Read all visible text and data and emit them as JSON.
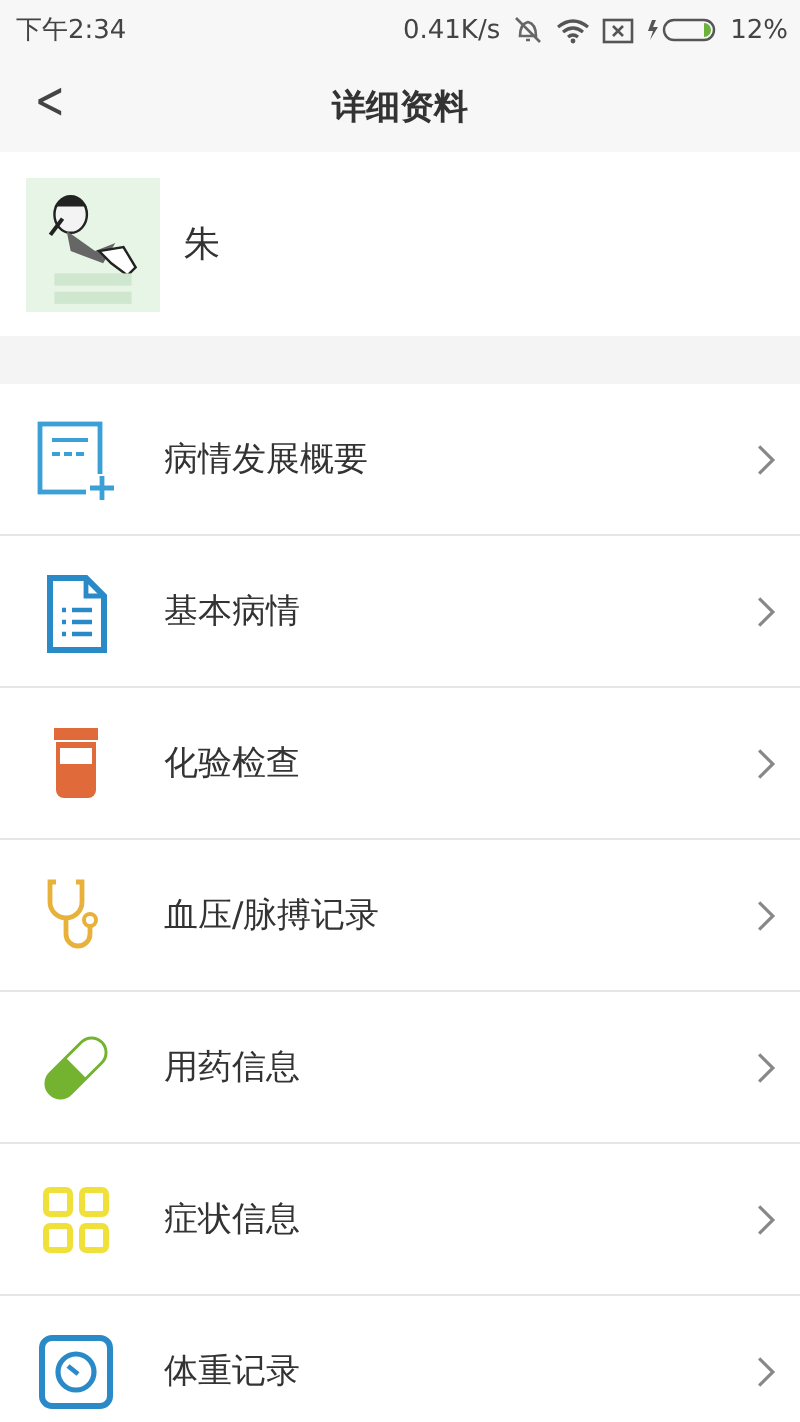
{
  "status_bar": {
    "time": "下午2:34",
    "speed": "0.41K/s",
    "battery": "12%"
  },
  "header": {
    "back": "<",
    "title": "详细资料"
  },
  "profile": {
    "name": "朱"
  },
  "items": [
    {
      "kind": "note-add",
      "label": "病情发展概要"
    },
    {
      "kind": "document",
      "label": "基本病情"
    },
    {
      "kind": "jar",
      "label": "化验检查"
    },
    {
      "kind": "stethoscope",
      "label": "血压/脉搏记录"
    },
    {
      "kind": "pill",
      "label": "用药信息"
    },
    {
      "kind": "grid",
      "label": "症状信息"
    },
    {
      "kind": "scale",
      "label": "体重记录"
    }
  ]
}
